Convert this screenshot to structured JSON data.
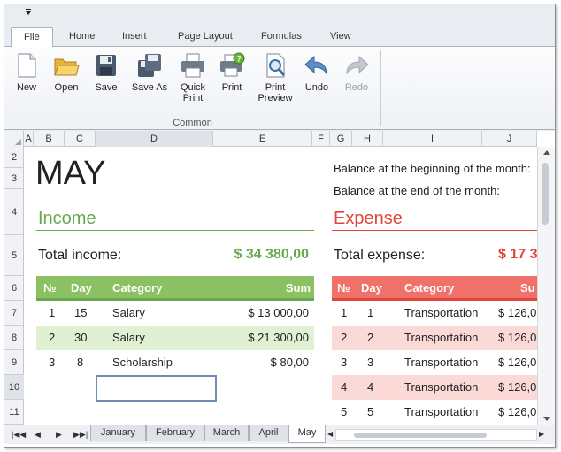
{
  "ribbon": {
    "tabs": [
      "File",
      "Home",
      "Insert",
      "Page Layout",
      "Formulas",
      "View"
    ],
    "buttons": {
      "new": "New",
      "open": "Open",
      "save": "Save",
      "save_as": "Save As",
      "quick_print_1": "Quick",
      "quick_print_2": "Print",
      "print": "Print",
      "print_preview_1": "Print",
      "print_preview_2": "Preview",
      "undo": "Undo",
      "redo": "Redo"
    },
    "group_label": "Common"
  },
  "columns": [
    "A",
    "B",
    "C",
    "D",
    "E",
    "F",
    "G",
    "H",
    "I",
    "J"
  ],
  "rows": [
    "2",
    "3",
    "4",
    "5",
    "6",
    "7",
    "8",
    "9",
    "10",
    "11"
  ],
  "sheet": {
    "month": "MAY",
    "balance_begin": "Balance at the beginning of the month:",
    "balance_end": "Balance at the end of the month:",
    "income": {
      "title": "Income",
      "total_label": "Total income:",
      "total_value": "$ 34 380,00",
      "headers": {
        "no": "№",
        "day": "Day",
        "category": "Category",
        "sum": "Sum"
      },
      "rows": [
        {
          "no": "1",
          "day": "15",
          "category": "Salary",
          "sum": "$ 13 000,00"
        },
        {
          "no": "2",
          "day": "30",
          "category": "Salary",
          "sum": "$ 21 300,00"
        },
        {
          "no": "3",
          "day": "8",
          "category": "Scholarship",
          "sum": "$ 80,00"
        }
      ]
    },
    "expense": {
      "title": "Expense",
      "total_label": "Total expense:",
      "total_value": "$ 17 3",
      "headers": {
        "no": "№",
        "day": "Day",
        "category": "Category",
        "sum": "Su"
      },
      "rows": [
        {
          "no": "1",
          "day": "1",
          "category": "Transportation",
          "sum": "$ 126,0"
        },
        {
          "no": "2",
          "day": "2",
          "category": "Transportation",
          "sum": "$ 126,0"
        },
        {
          "no": "3",
          "day": "3",
          "category": "Transportation",
          "sum": "$ 126,0"
        },
        {
          "no": "4",
          "day": "4",
          "category": "Transportation",
          "sum": "$ 126,0"
        },
        {
          "no": "5",
          "day": "5",
          "category": "Transportation",
          "sum": "$ 126,0"
        }
      ]
    }
  },
  "sheet_tabs": [
    "January",
    "February",
    "March",
    "April",
    "May"
  ],
  "nav_icons": [
    "first-sheet-icon",
    "prev-sheet-icon",
    "next-sheet-icon",
    "last-sheet-icon"
  ],
  "colors": {
    "income_green": "#6aa84f",
    "income_header": "#8bc063",
    "income_band": "#dff0d3",
    "expense_red": "#e2463a",
    "expense_header": "#f0706a",
    "expense_band": "#fbd9d6"
  }
}
